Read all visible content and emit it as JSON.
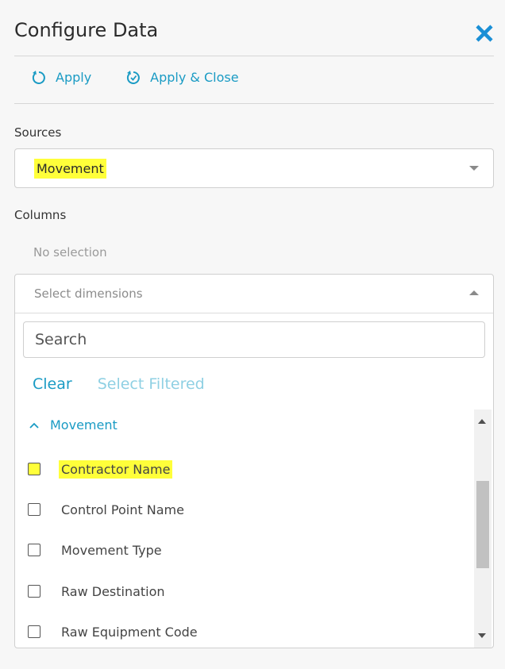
{
  "panel": {
    "title": "Configure Data",
    "close_icon": "close-icon",
    "accent_color": "#1a9bc4",
    "highlight_color": "#ffff3a"
  },
  "toolbar": {
    "apply_label": "Apply",
    "apply_close_label": "Apply & Close",
    "apply_icon": "refresh-icon",
    "apply_close_icon": "refresh-check-icon"
  },
  "sources": {
    "label": "Sources",
    "selected": "Movement"
  },
  "columns": {
    "label": "Columns",
    "no_selection_text": "No selection",
    "dimensions_placeholder": "Select dimensions",
    "search_placeholder": "Search",
    "clear_label": "Clear",
    "select_filtered_label": "Select Filtered",
    "group_label": "Movement",
    "items": [
      {
        "label": "Contractor Name",
        "checked": false,
        "highlighted": true
      },
      {
        "label": "Control Point Name",
        "checked": false,
        "highlighted": false
      },
      {
        "label": "Movement Type",
        "checked": false,
        "highlighted": false
      },
      {
        "label": "Raw Destination",
        "checked": false,
        "highlighted": false
      },
      {
        "label": "Raw Equipment Code",
        "checked": false,
        "highlighted": false
      }
    ]
  }
}
